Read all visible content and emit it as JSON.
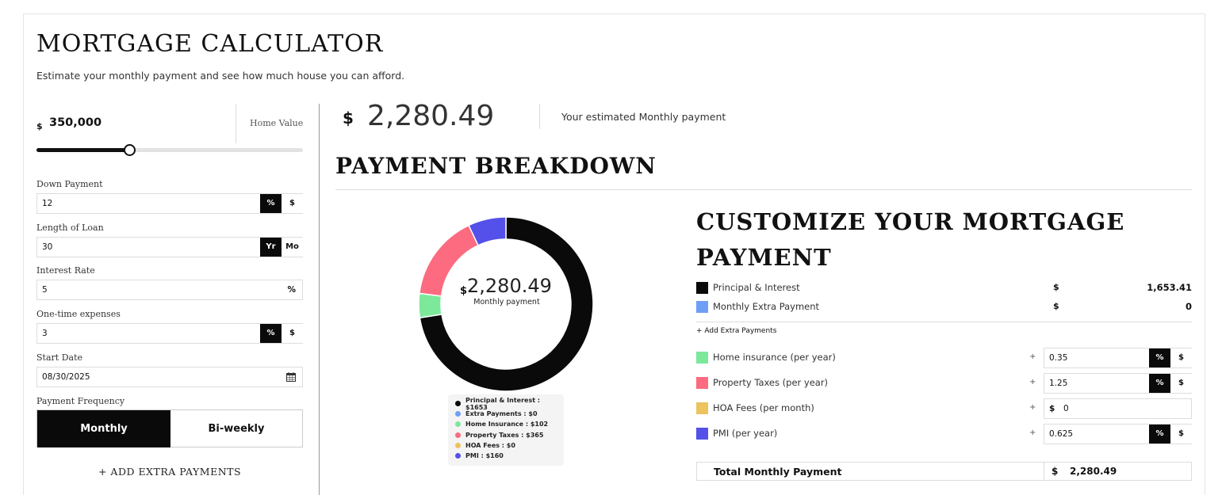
{
  "header": {
    "title": "MORTGAGE CALCULATOR",
    "subtitle": "Estimate your monthly payment and see how much house you can afford."
  },
  "home_value": {
    "currency": "$",
    "value": "350,000",
    "label": "Home Value",
    "slider_fraction": 0.35
  },
  "down_payment": {
    "label": "Down Payment",
    "value": "12",
    "unit_on": "%",
    "unit_off": "$"
  },
  "loan_length": {
    "label": "Length of Loan",
    "value": "30",
    "unit_on": "Yr",
    "unit_off": "Mo"
  },
  "interest_rate": {
    "label": "Interest Rate",
    "value": "5",
    "suffix": "%"
  },
  "one_time": {
    "label": "One-time expenses",
    "value": "3",
    "unit_on": "%",
    "unit_off": "$"
  },
  "start_date": {
    "label": "Start Date",
    "value": "08/30/2025"
  },
  "frequency": {
    "label": "Payment Frequency",
    "options": [
      "Monthly",
      "Bi-weekly"
    ],
    "selected": "Monthly"
  },
  "add_extra_label": "+ ADD EXTRA PAYMENTS",
  "monthly": {
    "currency": "$",
    "value": "2,280.49",
    "label": "Your estimated Monthly payment"
  },
  "breakdown": {
    "title": "PAYMENT BREAKDOWN",
    "center_currency": "$",
    "center_value": "2,280.49",
    "center_label": "Monthly payment"
  },
  "chart_data": {
    "type": "pie",
    "title": "",
    "categories": [
      "Principal & Interest",
      "Extra Payments",
      "Home Insurance",
      "Property Taxes",
      "HOA Fees",
      "PMI"
    ],
    "values": [
      1653,
      0,
      102,
      365,
      0,
      160
    ],
    "colors": [
      "#0a0a0a",
      "#6f9ef7",
      "#7ce89a",
      "#fc6b80",
      "#edc35e",
      "#5450ea"
    ],
    "legend": [
      "Principal & Interest : $1653",
      "Extra Payments : $0",
      "Home Insurance : $102",
      "Property Taxes : $365",
      "HOA Fees : $0",
      "PMI : $160"
    ],
    "legend_position": "bottom"
  },
  "customize": {
    "title": "CUSTOMIZE YOUR MORTGAGE PAYMENT",
    "principal": {
      "label": "Principal & Interest",
      "currency": "$",
      "amount": "1,653.41",
      "color": "#0a0a0a"
    },
    "extra": {
      "label": "Monthly Extra Payment",
      "currency": "$",
      "amount": "0",
      "color": "#6f9ef7"
    },
    "add_extra_link": "+ Add Extra Payments",
    "home_insurance": {
      "label": "Home insurance (per year)",
      "plus": "+",
      "value": "0.35",
      "unit_on": "%",
      "unit_off": "$",
      "color": "#7ce89a"
    },
    "property_taxes": {
      "label": "Property Taxes (per year)",
      "plus": "+",
      "value": "1.25",
      "unit_on": "%",
      "unit_off": "$",
      "color": "#fc6b80"
    },
    "hoa": {
      "label": "HOA Fees (per month)",
      "plus": "+",
      "currency": "$",
      "value": "0",
      "color": "#edc35e"
    },
    "pmi": {
      "label": "PMI (per year)",
      "plus": "+",
      "value": "0.625",
      "unit_on": "%",
      "unit_off": "$",
      "color": "#5450ea"
    },
    "total": {
      "label": "Total Monthly Payment",
      "currency": "$",
      "value": "2,280.49"
    }
  }
}
